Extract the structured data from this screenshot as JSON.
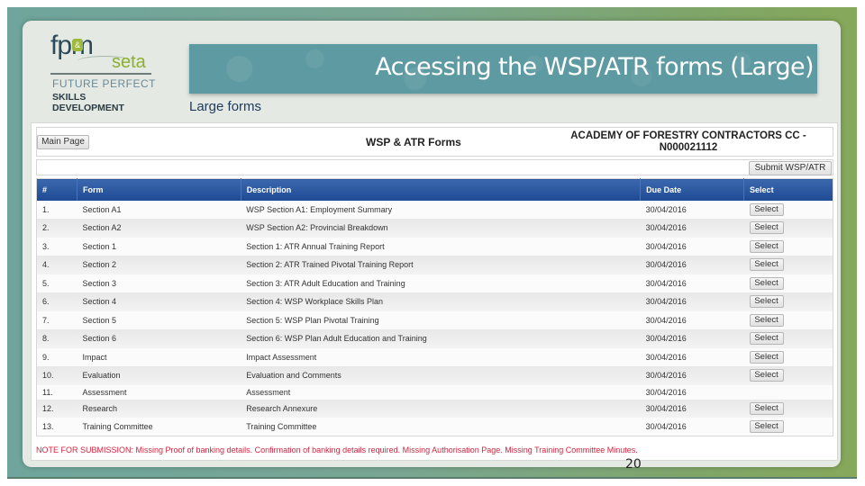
{
  "slide": {
    "title": "Accessing the WSP/ATR forms (Large)",
    "subtitle": "Large forms",
    "page_number": "20",
    "logo": {
      "brand": "fpm",
      "amp": "&",
      "seta": "seta",
      "line1": "FUTURE PERFECT",
      "line2": "SKILLS DEVELOPMENT"
    }
  },
  "app": {
    "main_page_label": "Main Page",
    "form_title": "WSP & ATR Forms",
    "organisation_line1": "ACADEMY OF FORESTRY CONTRACTORS CC -",
    "organisation_line2": "N000021112",
    "submit_label": "Submit WSP/ATR",
    "table": {
      "headers": [
        "#",
        "Form",
        "Description",
        "Due Date",
        "Select"
      ],
      "select_label": "Select",
      "rows": [
        {
          "num": "1.",
          "form": "Section A1",
          "description": "WSP Section A1: Employment Summary",
          "due": "30/04/2016",
          "has_select": true
        },
        {
          "num": "2.",
          "form": "Section A2",
          "description": "WSP Section A2: Provincial Breakdown",
          "due": "30/04/2016",
          "has_select": true
        },
        {
          "num": "3.",
          "form": "Section 1",
          "description": "Section 1: ATR Annual Training Report",
          "due": "30/04/2016",
          "has_select": true
        },
        {
          "num": "4.",
          "form": "Section 2",
          "description": "Section 2: ATR Trained Pivotal Training Report",
          "due": "30/04/2016",
          "has_select": true
        },
        {
          "num": "5.",
          "form": "Section 3",
          "description": "Section 3: ATR Adult Education and Training",
          "due": "30/04/2016",
          "has_select": true
        },
        {
          "num": "6.",
          "form": "Section 4",
          "description": "Section 4: WSP Workplace Skills Plan",
          "due": "30/04/2016",
          "has_select": true
        },
        {
          "num": "7.",
          "form": "Section 5",
          "description": "Section 5: WSP Plan Pivotal Training",
          "due": "30/04/2016",
          "has_select": true
        },
        {
          "num": "8.",
          "form": "Section 6",
          "description": "Section 6: WSP Plan Adult Education and Training",
          "due": "30/04/2016",
          "has_select": true
        },
        {
          "num": "9.",
          "form": "Impact",
          "description": "Impact Assessment",
          "due": "30/04/2016",
          "has_select": true
        },
        {
          "num": "10.",
          "form": "Evaluation",
          "description": "Evaluation and Comments",
          "due": "30/04/2016",
          "has_select": true
        },
        {
          "num": "11.",
          "form": "Assessment",
          "description": "Assessment",
          "due": "30/04/2016",
          "has_select": false
        },
        {
          "num": "12.",
          "form": "Research",
          "description": "Research Annexure",
          "due": "30/04/2016",
          "has_select": true
        },
        {
          "num": "13.",
          "form": "Training Committee",
          "description": "Training Committee",
          "due": "30/04/2016",
          "has_select": true
        }
      ]
    },
    "note": "NOTE FOR SUBMISSION: Missing Proof of banking details. Confirmation of banking details required. Missing Authorisation Page. Missing Training Committee Minutes."
  }
}
